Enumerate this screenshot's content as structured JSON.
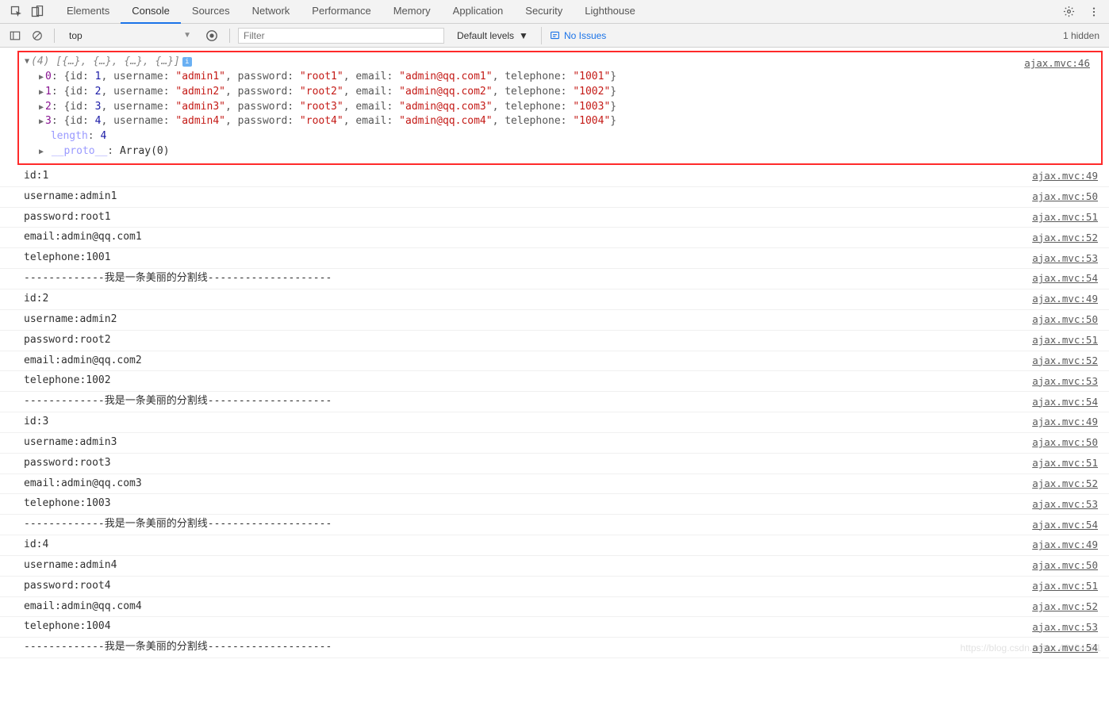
{
  "topbar": {
    "tabs": [
      "Elements",
      "Console",
      "Sources",
      "Network",
      "Performance",
      "Memory",
      "Application",
      "Security",
      "Lighthouse"
    ],
    "activeTab": 1
  },
  "toolbar": {
    "context": "top",
    "filterPlaceholder": "Filter",
    "levels": "Default levels",
    "noIssues": "No Issues",
    "hidden": "1 hidden"
  },
  "arrayDump": {
    "sourceLink": "ajax.mvc:46",
    "count": "4",
    "head": "[{…}, {…}, {…}, {…}]",
    "rows": [
      {
        "idx": "0",
        "id": "1",
        "username": "admin1",
        "password": "root1",
        "email": "admin@qq.com1",
        "telephone": "1001"
      },
      {
        "idx": "1",
        "id": "2",
        "username": "admin2",
        "password": "root2",
        "email": "admin@qq.com2",
        "telephone": "1002"
      },
      {
        "idx": "2",
        "id": "3",
        "username": "admin3",
        "password": "root3",
        "email": "admin@qq.com3",
        "telephone": "1003"
      },
      {
        "idx": "3",
        "id": "4",
        "username": "admin4",
        "password": "root4",
        "email": "admin@qq.com4",
        "telephone": "1004"
      }
    ],
    "length": "4",
    "proto": "Array(0)"
  },
  "divider": "-------------我是一条美丽的分割线--------------------",
  "records": [
    {
      "id": "1",
      "username": "admin1",
      "password": "root1",
      "email": "admin@qq.com1",
      "telephone": "1001"
    },
    {
      "id": "2",
      "username": "admin2",
      "password": "root2",
      "email": "admin@qq.com2",
      "telephone": "1002"
    },
    {
      "id": "3",
      "username": "admin3",
      "password": "root3",
      "email": "admin@qq.com3",
      "telephone": "1003"
    },
    {
      "id": "4",
      "username": "admin4",
      "password": "root4",
      "email": "admin@qq.com4",
      "telephone": "1004"
    }
  ],
  "lineMap": {
    "id": "49",
    "username": "50",
    "password": "51",
    "email": "52",
    "telephone": "53",
    "divider": "54"
  },
  "sourceFile": "ajax.mvc",
  "labels": {
    "length": "length",
    "proto": "__proto__",
    "id": "id",
    "username": "username",
    "password": "password",
    "email": "email",
    "telephone": "telephone"
  }
}
